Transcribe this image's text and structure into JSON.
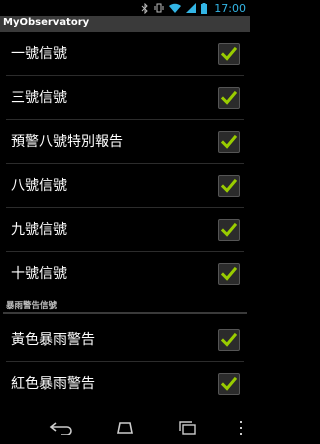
{
  "status_bar": {
    "time": "17:00"
  },
  "app": {
    "title": "MyObservatory"
  },
  "items": [
    {
      "label": "一號信號",
      "checked": true
    },
    {
      "label": "三號信號",
      "checked": true
    },
    {
      "label": "預警八號特別報告",
      "checked": true
    },
    {
      "label": "八號信號",
      "checked": true
    },
    {
      "label": "九號信號",
      "checked": true
    },
    {
      "label": "十號信號",
      "checked": true
    }
  ],
  "section": {
    "title": "暴雨警告信號"
  },
  "rain_items": [
    {
      "label": "黃色暴雨警告",
      "checked": true
    },
    {
      "label": "紅色暴雨警告",
      "checked": true
    }
  ],
  "colors": {
    "accent_check": "#99cc00",
    "clock": "#33b5e5"
  }
}
